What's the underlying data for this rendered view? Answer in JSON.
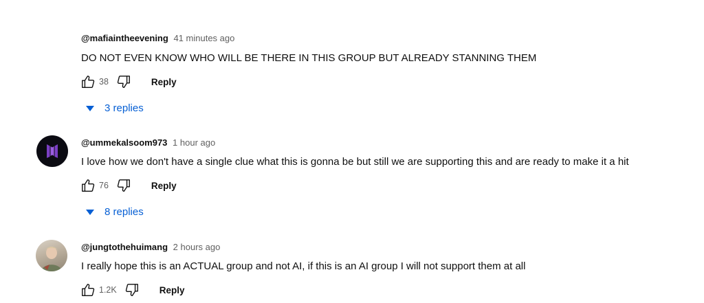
{
  "comments": [
    {
      "handle": "@mafiaintheevening",
      "time": "41 minutes ago",
      "text": "DO NOT EVEN KNOW WHO WILL BE THERE IN THIS GROUP BUT ALREADY STANNING THEM",
      "likes": "38",
      "reply_label": "Reply",
      "replies_label": "3 replies"
    },
    {
      "handle": "@ummekalsoom973",
      "time": "1 hour ago",
      "text": "I love how we don't have a single clue what this is gonna be but still we are supporting this and are ready to make it a hit",
      "likes": "76",
      "reply_label": "Reply",
      "replies_label": "8 replies"
    },
    {
      "handle": "@jungtothehuimang",
      "time": "2 hours ago",
      "text": "I really hope this is an ACTUAL group and not AI, if this is an AI group I will not support them at all",
      "likes": "1.2K",
      "reply_label": "Reply"
    }
  ],
  "colors": {
    "link": "#065fd4",
    "secondary_text": "#606060",
    "avatar_logo": "#7b3fc4"
  }
}
